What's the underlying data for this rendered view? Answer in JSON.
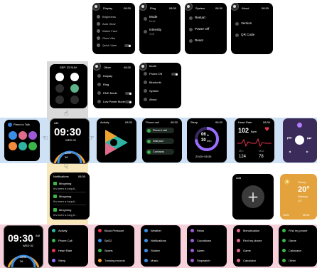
{
  "colors": {
    "blue_band": "#cfe2f5",
    "pink_band": "#f6d1db",
    "yellow_band": "#f7e7bb",
    "green": "#39b54a"
  },
  "top": {
    "display": {
      "title": "Display",
      "time": "08:30",
      "items": [
        "Brightness",
        "Auto Glow",
        "Watch Face",
        "Glow Vibe",
        "Quick View"
      ]
    },
    "ring": {
      "title": "Ring",
      "time": "08:30",
      "mode_label": "Mode",
      "mode_value": "Mute",
      "intensity_label": "Intensity",
      "intensity_value": "Soft"
    },
    "system": {
      "title": "System",
      "time": "08:30",
      "items": [
        "Restart",
        "Power Off",
        "Reset"
      ]
    },
    "about": {
      "title": "About",
      "time": "08:30",
      "items": [
        "Version",
        "QR Code"
      ]
    }
  },
  "quick": {
    "date": "SEP. 23 SUN"
  },
  "other": {
    "title": "Other",
    "time": "08:30",
    "items": [
      "Display",
      "Ring",
      "DND Mode",
      "Low Power Mode"
    ]
  },
  "other2": {
    "items": [
      "Mode",
      "Phone Off",
      "Bluetooth",
      "System",
      "About"
    ]
  },
  "watch": {
    "am": "AM",
    "time": "09:30",
    "date": "WED 02",
    "steps": "1200",
    "kcal": "36"
  },
  "press_talk": "Press to Talk",
  "activity": {
    "title": "Activity",
    "time": "08:30"
  },
  "phone": {
    "title": "Phone call",
    "time": "08:30",
    "items": [
      "Recent call",
      "Dial pad",
      "Contacts"
    ]
  },
  "sleep": {
    "title": "Sleep",
    "time": "08:30",
    "hours": "06",
    "hours_unit": "hr",
    "minutes": "30",
    "minutes_unit": "min",
    "range": "23:00~05:30"
  },
  "heart": {
    "title": "Heart Rate",
    "time": "08:30",
    "bpm": "102",
    "unit": "Bpm",
    "min_label": "Min",
    "max_label": "Max",
    "min": "124",
    "max": "78"
  },
  "notifications": {
    "title": "Notifications",
    "time": "08:30",
    "items": [
      {
        "app": "Mingming",
        "msg": "It's been a long ti..."
      },
      {
        "app": "Mingming",
        "msg": "It's been a long ti..."
      },
      {
        "app": "Mingming",
        "msg": "It's been a long ti..."
      }
    ]
  },
  "add": {
    "title": "Add"
  },
  "weather": {
    "label": "Sunny",
    "temp": "20°",
    "sub": "Raining",
    "low": "10°",
    "footer_left": "SUN",
    "footer_right": "MON"
  },
  "bottom": {
    "watch": {
      "time": "09:30",
      "am": "AM",
      "date": "WED 02",
      "steps": "1200",
      "kcal": "36"
    },
    "lists": [
      [
        "Activity",
        "Phone Call",
        "Heart Rate",
        "Sleep"
      ],
      [
        "Blood Pressure",
        "SpO2",
        "Sports",
        "Training records"
      ],
      [
        "Weather",
        "Notifications",
        "Shutter",
        "Music"
      ],
      [
        "Relax",
        "Countdown",
        "Alarm",
        "Stopwatch"
      ],
      [
        "Menstruation",
        "Find my phone",
        "Game",
        "Calculator"
      ],
      [
        "Find my phone",
        "Game",
        "Calculator",
        "Other"
      ]
    ]
  }
}
